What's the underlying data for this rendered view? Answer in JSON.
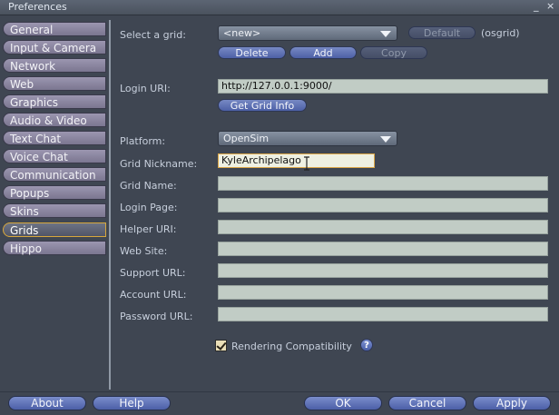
{
  "window": {
    "title": "Preferences",
    "minimize": "_",
    "close": "×"
  },
  "sidebar": {
    "items": [
      {
        "label": "General"
      },
      {
        "label": "Input & Camera"
      },
      {
        "label": "Network"
      },
      {
        "label": "Web"
      },
      {
        "label": "Graphics"
      },
      {
        "label": "Audio & Video"
      },
      {
        "label": "Text Chat"
      },
      {
        "label": "Voice Chat"
      },
      {
        "label": "Communication"
      },
      {
        "label": "Popups"
      },
      {
        "label": "Skins"
      },
      {
        "label": "Grids",
        "active": true
      },
      {
        "label": "Hippo"
      }
    ]
  },
  "grids": {
    "select_label": "Select a grid:",
    "select_value": "<new>",
    "default_button": "Default",
    "current_grid": "(osgrid)",
    "delete_button": "Delete",
    "add_button": "Add",
    "copy_button": "Copy",
    "login_uri_label": "Login URI:",
    "login_uri_value": "http://127.0.0.1:9000/",
    "get_grid_info_button": "Get Grid Info",
    "platform_label": "Platform:",
    "platform_value": "OpenSim",
    "nickname_label": "Grid Nickname:",
    "nickname_value": "KyleArchipelago",
    "grid_name_label": "Grid Name:",
    "login_page_label": "Login Page:",
    "helper_uri_label": "Helper URI:",
    "website_label": "Web Site:",
    "support_url_label": "Support URL:",
    "account_url_label": "Account URL:",
    "password_url_label": "Password URL:",
    "grid_name_value": "",
    "login_page_value": "",
    "helper_uri_value": "",
    "website_value": "",
    "support_url_value": "",
    "account_url_value": "",
    "password_url_value": "",
    "rendering_compat_label": "Rendering Compatibility",
    "rendering_compat_checked": true,
    "help_glyph": "?"
  },
  "footer": {
    "about": "About",
    "help": "Help",
    "ok": "OK",
    "cancel": "Cancel",
    "apply": "Apply"
  }
}
